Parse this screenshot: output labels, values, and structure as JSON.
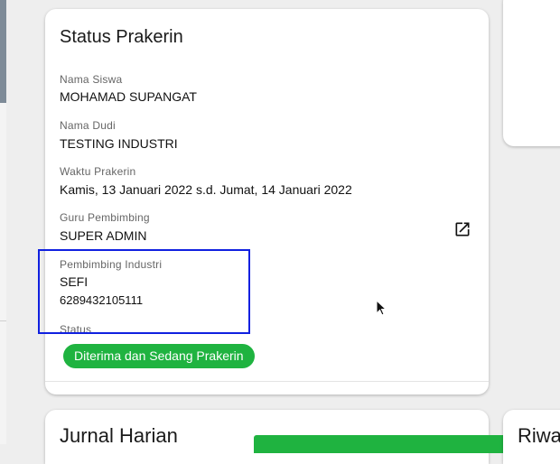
{
  "status_card": {
    "title": "Status Prakerin",
    "fields": [
      {
        "label": "Nama Siswa",
        "value": "MOHAMAD SUPANGAT"
      },
      {
        "label": "Nama Dudi",
        "value": "TESTING INDUSTRI"
      },
      {
        "label": "Waktu Prakerin",
        "value": "Kamis, 13 Januari 2022 s.d. Jumat, 14 Januari 2022"
      },
      {
        "label": "Guru Pembimbing",
        "value": "SUPER ADMIN"
      },
      {
        "label": "Pembimbing Industri",
        "value": "SEFI",
        "phone": "6289432105111"
      }
    ],
    "status_label": "Status",
    "status_value": "Diterima dan Sedang Prakerin",
    "open_icon": "open-in-new-icon"
  },
  "bottom_cards": {
    "journal_title": "Jurnal Harian",
    "history_title": "Riwa"
  },
  "colors": {
    "status_green": "#1fb340",
    "highlight_blue": "#1020e0"
  }
}
